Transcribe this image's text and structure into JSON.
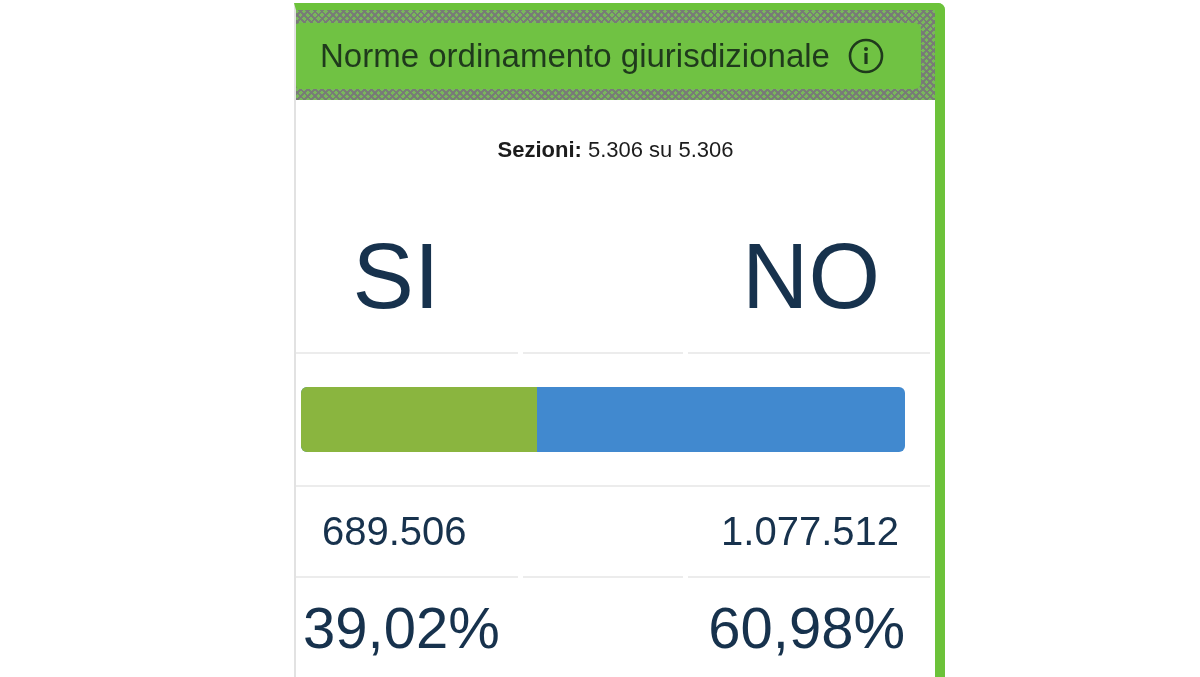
{
  "referendum": {
    "title": "Norme ordinamento giurisdizionale"
  },
  "sections": "**Sezioni:** 5.306 su 5.306",
  "options": [
    {
      "label": "SI",
      "votes": "689.506",
      "percent": "39,02%",
      "color": "#8ab53f"
    },
    {
      "label": "NO",
      "votes": "1.077.512",
      "percent": "60,98%",
      "color": "#4189cf"
    }
  ],
  "result_bar": {
    "level": 0.3902
  }
}
